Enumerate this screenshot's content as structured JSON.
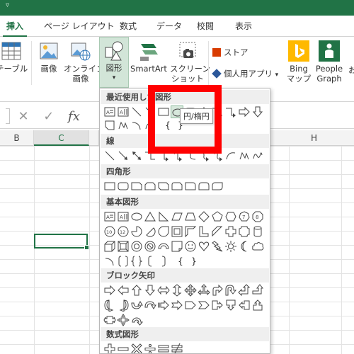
{
  "tabs": [
    {
      "label": "挿入",
      "active": true
    },
    {
      "label": "ページ レイアウト"
    },
    {
      "label": "数式"
    },
    {
      "label": "データ"
    },
    {
      "label": "校閲"
    },
    {
      "label": "表示"
    }
  ],
  "ribbon": {
    "table_label": "テーブル",
    "picture_label": "画像",
    "online_picture_label1": "オンライン",
    "online_picture_label2": "画像",
    "shapes_label": "図形",
    "smartart_label": "SmartArt",
    "screenshot_label1": "スクリーン",
    "screenshot_label2": "ショット",
    "store_label": "ストア",
    "personal_apps_label": "個人用アプリ",
    "bing_label1": "Bing",
    "bing_label2": "マップ",
    "people_label1": "People",
    "people_label2": "Graph",
    "truncated_label": "お"
  },
  "formula": {
    "cancel": "✕",
    "enter": "✓",
    "fx": "fx"
  },
  "columns": {
    "b": "B",
    "c": "C",
    "h": "H"
  },
  "gallery": {
    "sections": {
      "recent": "最近使用した図形",
      "lines": "線",
      "rect": "四角形",
      "basic": "基本図形",
      "block": "ブロック矢印",
      "math": "数式図形"
    },
    "tooltip": "円/楕円",
    "brace_glyphs": {
      "recent_open": "{",
      "recent_close": "}",
      "basic_open": "{",
      "basic_close": "}"
    }
  },
  "colors": {
    "accent": "#217346",
    "highlight": "#ff0000",
    "store_icon": "#d83b01",
    "personal_apps_icon": "#2b579a",
    "bing": "#ffb900",
    "people_graph": "#217346"
  }
}
